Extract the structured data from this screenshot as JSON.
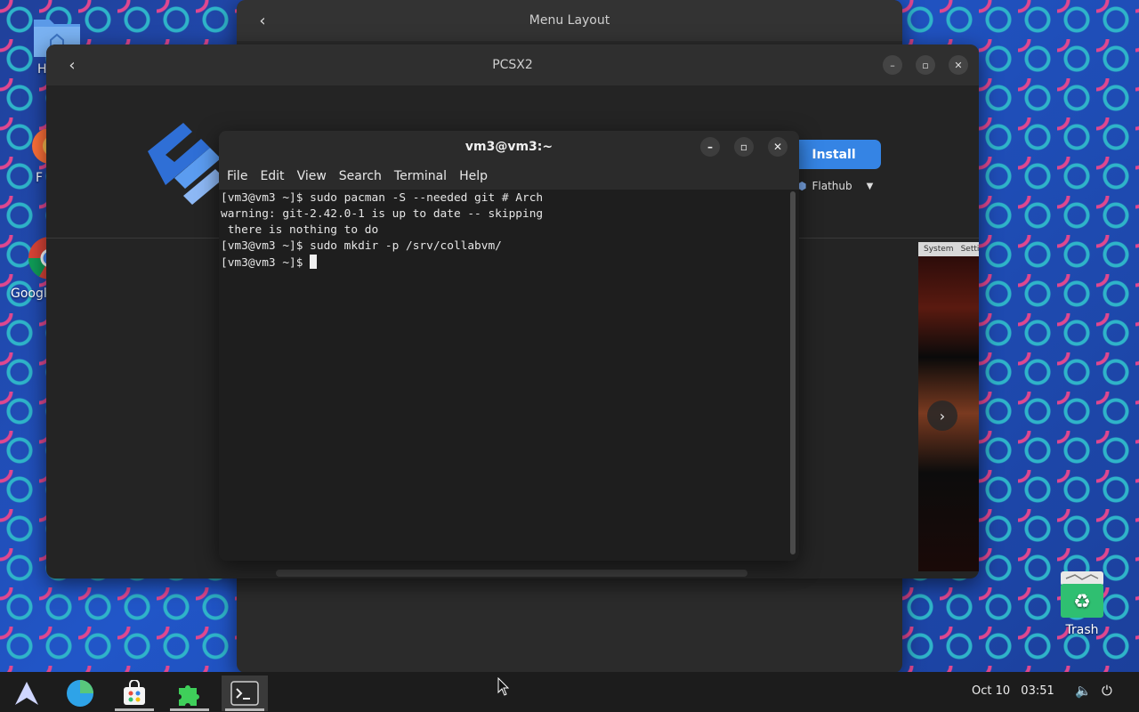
{
  "desktop": {
    "icons": [
      {
        "label": "H",
        "icon": "home-folder-icon"
      },
      {
        "label": "F",
        "icon": "firefox-icon"
      },
      {
        "label": "Googl",
        "icon": "chrome-icon"
      }
    ],
    "trash_label": "Trash"
  },
  "menu_layout_window": {
    "title": "Menu Layout"
  },
  "pcsx2_window": {
    "title": "PCSX2",
    "install_label": "Install",
    "source_label": "Flathub",
    "strip_tabs": [
      "System",
      "Setti"
    ]
  },
  "terminal": {
    "title": "vm3@vm3:~",
    "menu": [
      "File",
      "Edit",
      "View",
      "Search",
      "Terminal",
      "Help"
    ],
    "lines": [
      "[vm3@vm3 ~]$ sudo pacman -S --needed git # Arch",
      "warning: git-2.42.0-1 is up to date -- skipping",
      " there is nothing to do",
      "[vm3@vm3 ~]$ sudo mkdir -p /srv/collabvm/",
      "[vm3@vm3 ~]$ "
    ]
  },
  "taskbar": {
    "apps": [
      "arch-menu-icon",
      "browser-globe-icon",
      "software-store-icon",
      "extensions-puzzle-icon",
      "terminal-icon"
    ],
    "date": "Oct 10",
    "time": "03:51"
  },
  "colors": {
    "accent": "#3584e4",
    "taskbar": "#1c1c1c",
    "window": "#242424"
  }
}
